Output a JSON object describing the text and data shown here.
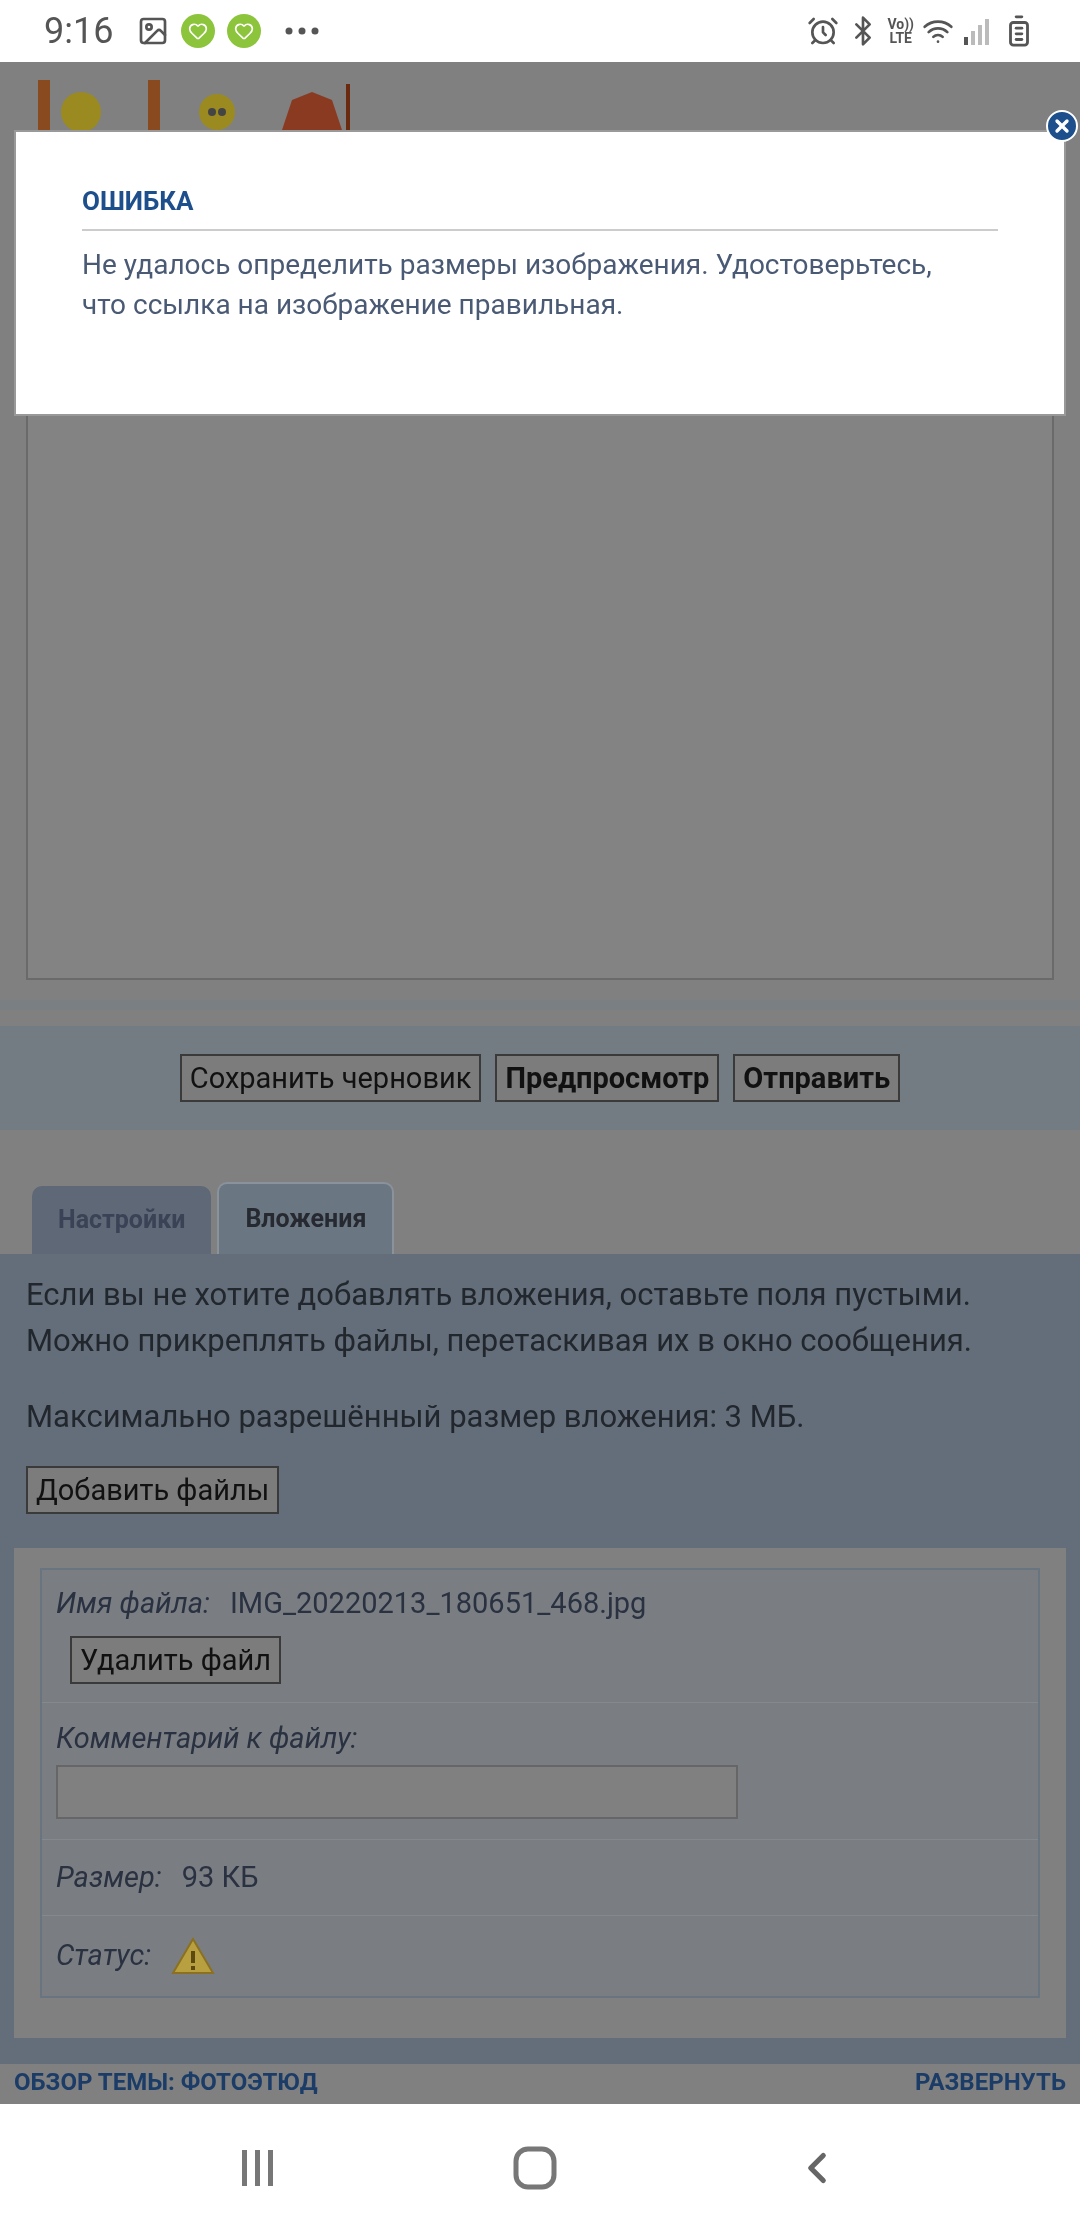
{
  "status_bar": {
    "time": "9:16",
    "network_label": "Vo))",
    "network_sub": "LTE"
  },
  "dialog": {
    "title": "ОШИБКА",
    "message": "Не удалось определить размеры изображения. Удостоверьтесь, что ссылка на изображение правильная."
  },
  "form_buttons": [
    {
      "label": "Сохранить черновик",
      "bold": false
    },
    {
      "label": "Предпросмотр",
      "bold": true
    },
    {
      "label": "Отправить",
      "bold": true
    }
  ],
  "tabs": [
    {
      "label": "Настройки",
      "selected": false
    },
    {
      "label": "Вложения",
      "selected": true
    }
  ],
  "attachments": {
    "info": [
      "Если вы не хотите добавлять вложения, оставьте поля пустыми.",
      "Можно прикреплять файлы, перетаскивая их в окно сообщения."
    ],
    "max_size": "Максимально разрешённый размер вложения: 3 МБ.",
    "add_button": "Добавить файлы",
    "file": {
      "name_label": "Имя файла:",
      "name": "IMG_20220213_180651_468.jpg",
      "delete_button": "Удалить файл",
      "comment_label": "Комментарий к файлу:",
      "size_label": "Размер:",
      "size": "93 КБ",
      "status_label": "Статус:"
    }
  },
  "topic_review": {
    "title": "ОБЗОР ТЕМЫ: ФОТОЭТЮД",
    "toggle": "РАЗВЕРНУТЬ"
  }
}
